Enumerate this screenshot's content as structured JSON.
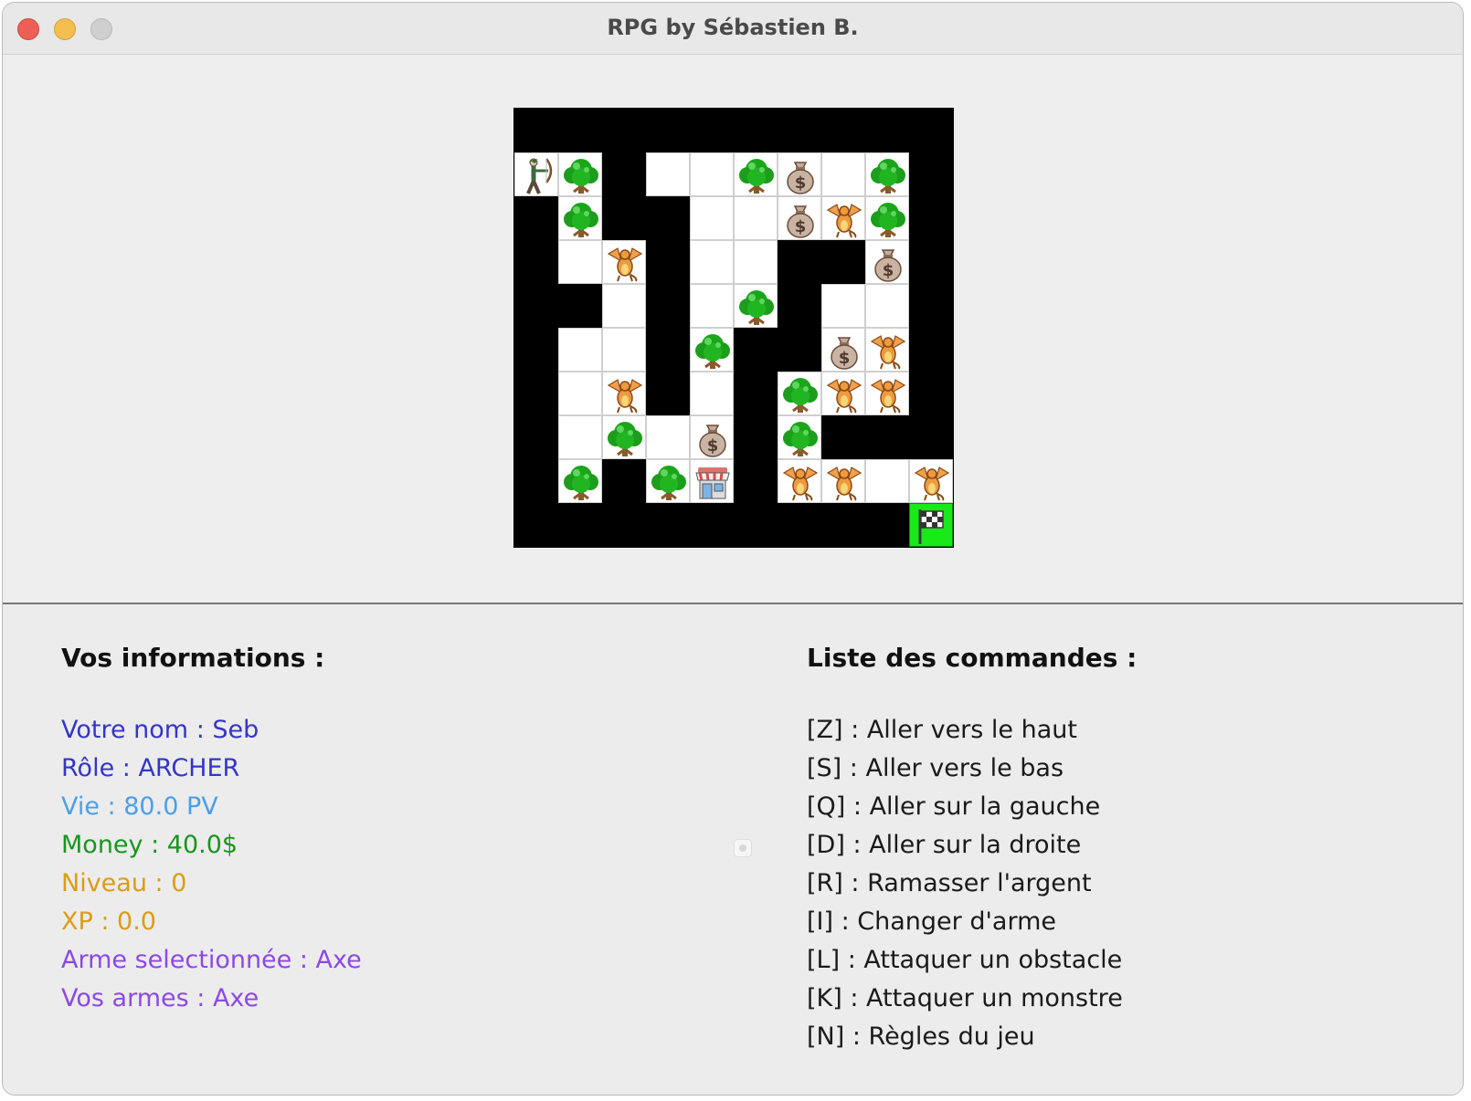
{
  "window": {
    "title": "RPG by Sébastien B."
  },
  "board": {
    "rows": 10,
    "cols": 10,
    "cells": [
      {
        "row": 1,
        "col": 0,
        "type": "path",
        "item": "archer"
      },
      {
        "row": 1,
        "col": 1,
        "type": "path",
        "item": "tree"
      },
      {
        "row": 1,
        "col": 3,
        "type": "path",
        "item": ""
      },
      {
        "row": 1,
        "col": 4,
        "type": "path",
        "item": ""
      },
      {
        "row": 1,
        "col": 5,
        "type": "path",
        "item": "tree"
      },
      {
        "row": 1,
        "col": 6,
        "type": "path",
        "item": "money"
      },
      {
        "row": 1,
        "col": 7,
        "type": "path",
        "item": ""
      },
      {
        "row": 1,
        "col": 8,
        "type": "path",
        "item": "tree"
      },
      {
        "row": 2,
        "col": 1,
        "type": "path",
        "item": "tree"
      },
      {
        "row": 2,
        "col": 4,
        "type": "path",
        "item": ""
      },
      {
        "row": 2,
        "col": 5,
        "type": "path",
        "item": ""
      },
      {
        "row": 2,
        "col": 6,
        "type": "path",
        "item": "money"
      },
      {
        "row": 2,
        "col": 7,
        "type": "path",
        "item": "dragon"
      },
      {
        "row": 2,
        "col": 8,
        "type": "path",
        "item": "tree"
      },
      {
        "row": 3,
        "col": 1,
        "type": "path",
        "item": ""
      },
      {
        "row": 3,
        "col": 2,
        "type": "path",
        "item": "dragon"
      },
      {
        "row": 3,
        "col": 4,
        "type": "path",
        "item": ""
      },
      {
        "row": 3,
        "col": 5,
        "type": "path",
        "item": ""
      },
      {
        "row": 3,
        "col": 8,
        "type": "path",
        "item": "money"
      },
      {
        "row": 4,
        "col": 2,
        "type": "path",
        "item": ""
      },
      {
        "row": 4,
        "col": 4,
        "type": "path",
        "item": ""
      },
      {
        "row": 4,
        "col": 5,
        "type": "path",
        "item": "tree"
      },
      {
        "row": 4,
        "col": 7,
        "type": "path",
        "item": ""
      },
      {
        "row": 4,
        "col": 8,
        "type": "path",
        "item": ""
      },
      {
        "row": 5,
        "col": 1,
        "type": "path",
        "item": ""
      },
      {
        "row": 5,
        "col": 2,
        "type": "path",
        "item": ""
      },
      {
        "row": 5,
        "col": 4,
        "type": "path",
        "item": "tree"
      },
      {
        "row": 5,
        "col": 7,
        "type": "path",
        "item": "money"
      },
      {
        "row": 5,
        "col": 8,
        "type": "path",
        "item": "dragon"
      },
      {
        "row": 6,
        "col": 1,
        "type": "path",
        "item": ""
      },
      {
        "row": 6,
        "col": 2,
        "type": "path",
        "item": "dragon"
      },
      {
        "row": 6,
        "col": 4,
        "type": "path",
        "item": ""
      },
      {
        "row": 6,
        "col": 6,
        "type": "path",
        "item": "tree"
      },
      {
        "row": 6,
        "col": 7,
        "type": "path",
        "item": "dragon"
      },
      {
        "row": 6,
        "col": 8,
        "type": "path",
        "item": "dragon"
      },
      {
        "row": 7,
        "col": 1,
        "type": "path",
        "item": ""
      },
      {
        "row": 7,
        "col": 2,
        "type": "path",
        "item": "tree"
      },
      {
        "row": 7,
        "col": 3,
        "type": "path",
        "item": ""
      },
      {
        "row": 7,
        "col": 4,
        "type": "path",
        "item": "money"
      },
      {
        "row": 7,
        "col": 6,
        "type": "path",
        "item": "tree"
      },
      {
        "row": 8,
        "col": 1,
        "type": "path",
        "item": "tree"
      },
      {
        "row": 8,
        "col": 3,
        "type": "path",
        "item": "tree"
      },
      {
        "row": 8,
        "col": 4,
        "type": "path",
        "item": "shop"
      },
      {
        "row": 8,
        "col": 6,
        "type": "path",
        "item": "dragon"
      },
      {
        "row": 8,
        "col": 7,
        "type": "path",
        "item": "dragon"
      },
      {
        "row": 8,
        "col": 8,
        "type": "path",
        "item": ""
      },
      {
        "row": 8,
        "col": 9,
        "type": "path",
        "item": "dragon"
      },
      {
        "row": 9,
        "col": 9,
        "type": "finish",
        "item": "flag"
      }
    ]
  },
  "info": {
    "heading": "Vos informations :",
    "lines": [
      {
        "text": "Votre nom : Seb",
        "color": "#3535c8"
      },
      {
        "text": "Rôle : ARCHER",
        "color": "#3535c8"
      },
      {
        "text": "Vie : 80.0 PV",
        "color": "#4aa0ea"
      },
      {
        "text": "Money : 40.0$",
        "color": "#18961e"
      },
      {
        "text": "Niveau : 0",
        "color": "#dc9c14"
      },
      {
        "text": "XP : 0.0",
        "color": "#dc9c14"
      },
      {
        "text": "Arme selectionnée : Axe",
        "color": "#8d48e6"
      },
      {
        "text": "Vos armes : Axe",
        "color": "#8d48e6"
      }
    ]
  },
  "commands": {
    "heading": "Liste des commandes :",
    "lines": [
      "[Z] : Aller vers le haut",
      "[S] : Aller vers le bas",
      "[Q] : Aller sur la gauche",
      "[D] : Aller sur la droite",
      "[R] : Ramasser l'argent",
      "[I] : Changer d'arme",
      "[L] : Attaquer un obstacle",
      "[K] : Attaquer un monstre",
      "[N] : Règles du jeu"
    ]
  },
  "icons": {
    "archer": "archer-icon",
    "tree": "tree-icon",
    "money": "money-bag-icon",
    "dragon": "dragon-icon",
    "shop": "shop-icon",
    "flag": "finish-flag-icon"
  }
}
